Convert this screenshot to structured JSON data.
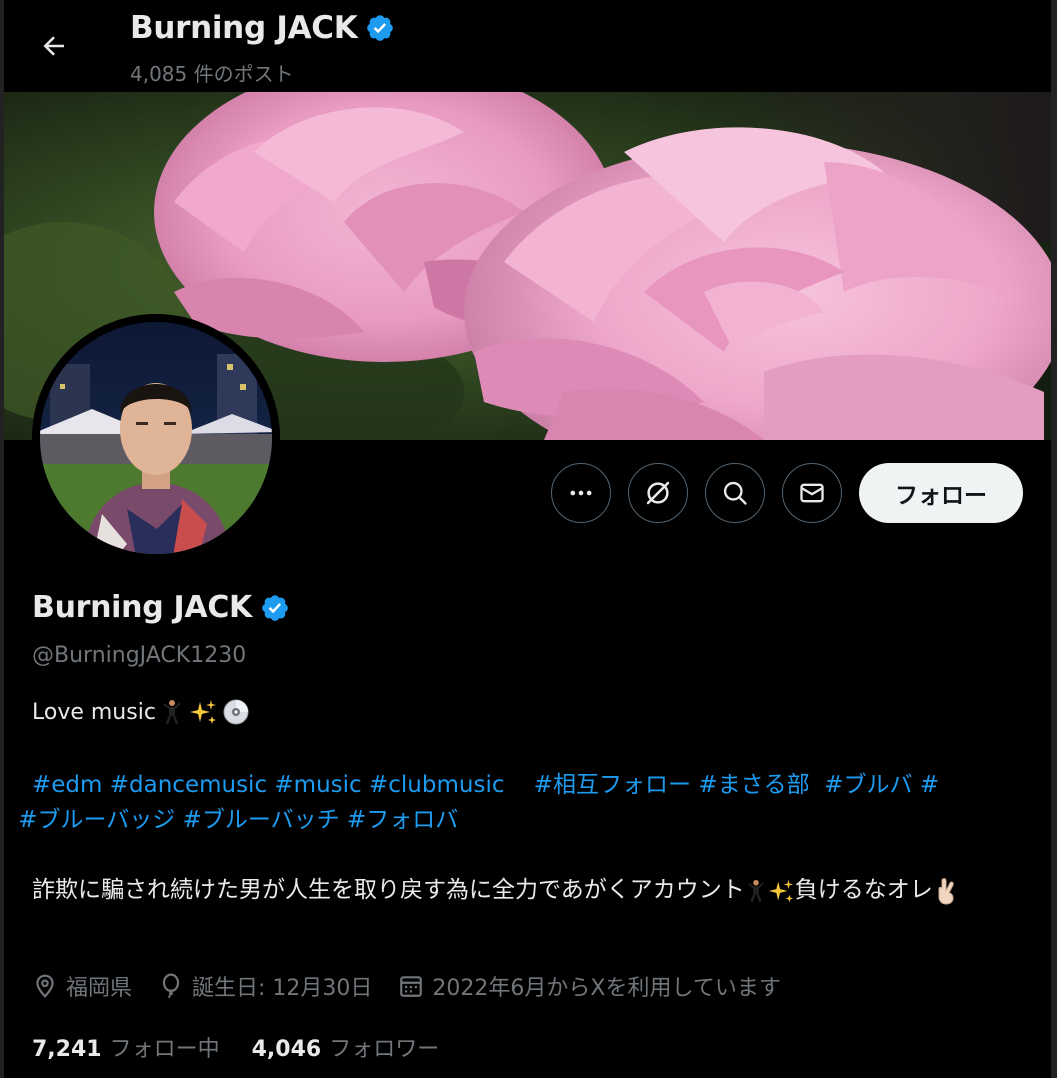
{
  "header": {
    "display_name": "Burning JACK",
    "post_count": "4,085 件のポスト"
  },
  "profile": {
    "display_name": "Burning JACK",
    "handle": "@BurningJACK1230",
    "bio_line1": "Love music",
    "hashtags": [
      "#edm",
      "#dancemusic",
      "#music",
      "#clubmusic",
      "#相互フォロー",
      "#まさる部",
      "#ブルバ",
      "#ブルーバッジ",
      "#ブルーバッチ",
      "#フォロバ"
    ],
    "bio_line3_a": "詐欺に騙され続けた男が人生を取り戻す為に全力であがくアカウント",
    "bio_line3_b": "負けるなオレ",
    "location": "福岡県",
    "birthday": "誕生日: 12月30日",
    "joined": "2022年6月からXを利用しています",
    "following_count": "7,241",
    "following_label": "フォロー中",
    "followers_count": "4,046",
    "followers_label": "フォロワー"
  },
  "actions": {
    "follow_label": "フォロー"
  },
  "colors": {
    "background": "#000000",
    "text_primary": "#e7e9ea",
    "text_secondary": "#71767b",
    "link": "#1d9bf0",
    "verified": "#1d9bf0",
    "button_light": "#eff3f4"
  },
  "icons": [
    "back-arrow-icon",
    "verified-badge-icon",
    "more-icon",
    "grok-icon",
    "search-icon",
    "mail-icon",
    "location-icon",
    "birthday-balloon-icon",
    "calendar-icon"
  ]
}
